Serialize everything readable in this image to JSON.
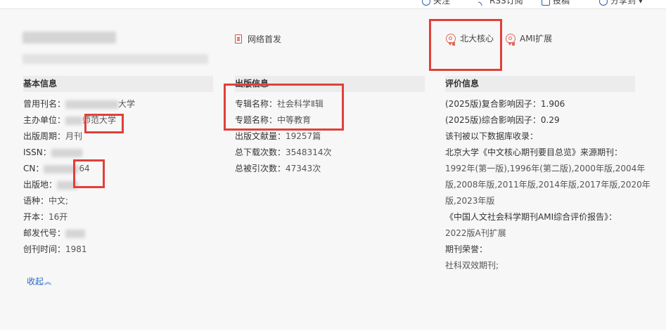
{
  "top_actions": [
    {
      "label": "关注"
    },
    {
      "label": "RSS订阅"
    },
    {
      "label": "投稿"
    },
    {
      "label": "分享到 ▾"
    }
  ],
  "pub_first": {
    "label": "网络首发"
  },
  "badges": [
    {
      "label": "北大核心"
    },
    {
      "label": "AMI扩展"
    }
  ],
  "basic_info": {
    "title": "基本信息",
    "rows": [
      {
        "label": "曾用刊名：",
        "value": "大学"
      },
      {
        "label": "主办单位：",
        "value": "师范大学"
      },
      {
        "label": "出版周期：",
        "value": "月刊"
      },
      {
        "label": "ISSN：",
        "value": ""
      },
      {
        "label": "CN：",
        "value": "64"
      },
      {
        "label": "出版地：",
        "value": ""
      },
      {
        "label": "语种：",
        "value": "中文;"
      },
      {
        "label": "开本：",
        "value": "16开"
      },
      {
        "label": "邮发代号：",
        "value": ""
      },
      {
        "label": "创刊时间：",
        "value": "1981"
      }
    ],
    "collapse_label": "收起",
    "collapse_icon": "double-chevron-up-icon"
  },
  "publish_info": {
    "title": "出版信息",
    "rows": [
      {
        "label": "专辑名称：",
        "value": "社会科学Ⅱ辑"
      },
      {
        "label": "专题名称：",
        "value": "中等教育"
      },
      {
        "label": "出版文献量：",
        "value": "19257篇"
      },
      {
        "label": "总下载次数：",
        "value": "3548314次"
      },
      {
        "label": "总被引次数：",
        "value": "47343次"
      }
    ]
  },
  "eval_info": {
    "title": "评价信息",
    "lines": [
      "(2025版)复合影响因子：1.906",
      "(2025版)综合影响因子：0.29",
      "该刊被以下数据库收录：",
      "北京大学《中文核心期刊要目总览》来源期刊：",
      "1992年(第一版),1996年(第二版),2000年版,2004年",
      "版,2008年版,2011年版,2014年版,2017年版,2020年",
      "版,2023年版",
      "《中国人文社会科学期刊AMI综合评价报告》：",
      "2022版A刊扩展",
      "期刊荣誉：",
      "社科双效期刊;"
    ]
  },
  "colors": {
    "highlight_border": "#e0403a",
    "accent_red": "#d9534f",
    "link_blue": "#2a6ac0",
    "section_header_bg": "#ececec"
  }
}
